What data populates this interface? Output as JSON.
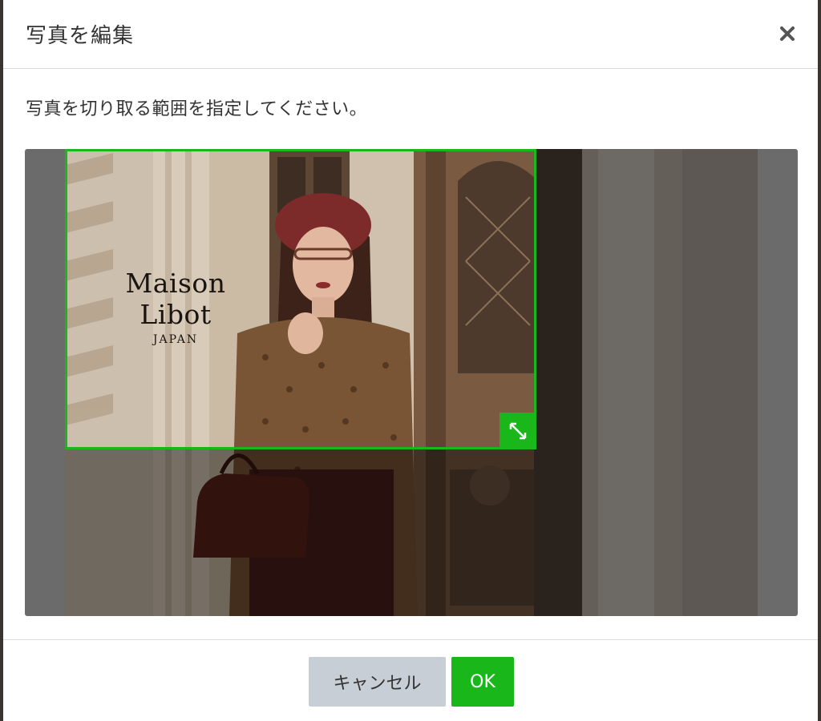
{
  "dialog": {
    "title": "写真を編集",
    "close_icon": "close-icon"
  },
  "body": {
    "instruction": "写真を切り取る範囲を指定してください。"
  },
  "photo": {
    "logo_name": "Maison Libot",
    "logo_sub": "JAPAN"
  },
  "crop": {
    "handle_icon": "resize-diagonal-icon",
    "accent_color": "#19b719"
  },
  "footer": {
    "cancel_label": "キャンセル",
    "ok_label": "OK"
  }
}
